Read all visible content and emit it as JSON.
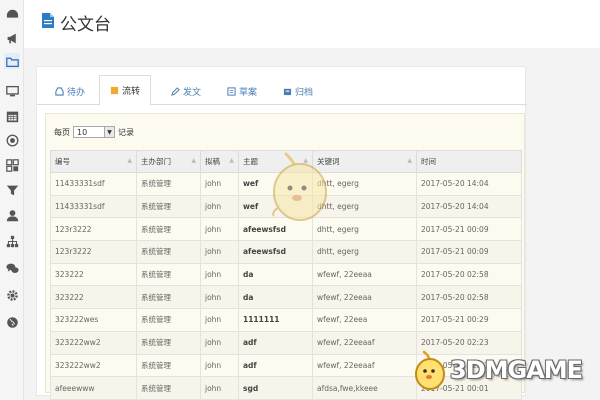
{
  "header": {
    "title": "公文台"
  },
  "sidebar": {
    "icons": [
      "dashboard-icon",
      "megaphone-icon",
      "folder-icon",
      "desktop-icon",
      "calendar-icon",
      "target-icon",
      "grid-icon",
      "filter-icon",
      "user-icon",
      "sitemap-icon",
      "chat-icon",
      "gear-icon",
      "globe-icon"
    ]
  },
  "tabs": [
    {
      "label": "待办",
      "icon": "inbox-icon"
    },
    {
      "label": "流转",
      "icon": "transfer-icon"
    },
    {
      "label": "发文",
      "icon": "edit-icon"
    },
    {
      "label": "草案",
      "icon": "draft-icon"
    },
    {
      "label": "归档",
      "icon": "archive-icon"
    }
  ],
  "pagesize": {
    "prefix": "每页",
    "value": "10",
    "suffix": "记录"
  },
  "table": {
    "columns": [
      "编号",
      "主办部门",
      "拟稿",
      "主题",
      "关键词",
      "时间"
    ],
    "rows": [
      [
        "11433331sdf",
        "系统管理",
        "john",
        "wef",
        "dhtt, egerg",
        "2017-05-20 14:04"
      ],
      [
        "11433331sdf",
        "系统管理",
        "john",
        "wef",
        "dhtt, egerg",
        "2017-05-20 14:04"
      ],
      [
        "123r3222",
        "系统管理",
        "john",
        "afeewsfsd",
        "dhtt, egerg",
        "2017-05-21 00:09"
      ],
      [
        "123r3222",
        "系统管理",
        "john",
        "afeewsfsd",
        "dhtt, egerg",
        "2017-05-21 00:09"
      ],
      [
        "323222",
        "系统管理",
        "john",
        "da",
        "wfewf, 22eeaa",
        "2017-05-20 02:58"
      ],
      [
        "323222",
        "系统管理",
        "john",
        "da",
        "wfewf, 22eeaa",
        "2017-05-20 02:58"
      ],
      [
        "323222wes",
        "系统管理",
        "john",
        "1111111",
        "wfewf, 22eea",
        "2017-05-21 00:29"
      ],
      [
        "323222ww2",
        "系统管理",
        "john",
        "adf",
        "wfewf, 22eeaaf",
        "2017-05-20 02:23"
      ],
      [
        "323222ww2",
        "系统管理",
        "john",
        "adf",
        "wfewf, 22eeaaf",
        "2017-05-20 02:23"
      ],
      [
        "afeeewww",
        "系统管理",
        "john",
        "sgd",
        "afdsa,fwe,kkeee",
        "2017-05-21 00:01"
      ]
    ]
  },
  "watermark": {
    "text": "3DMGAME"
  },
  "colors": {
    "accent": "#4a7fb5",
    "panel": "#fdfaf0"
  }
}
